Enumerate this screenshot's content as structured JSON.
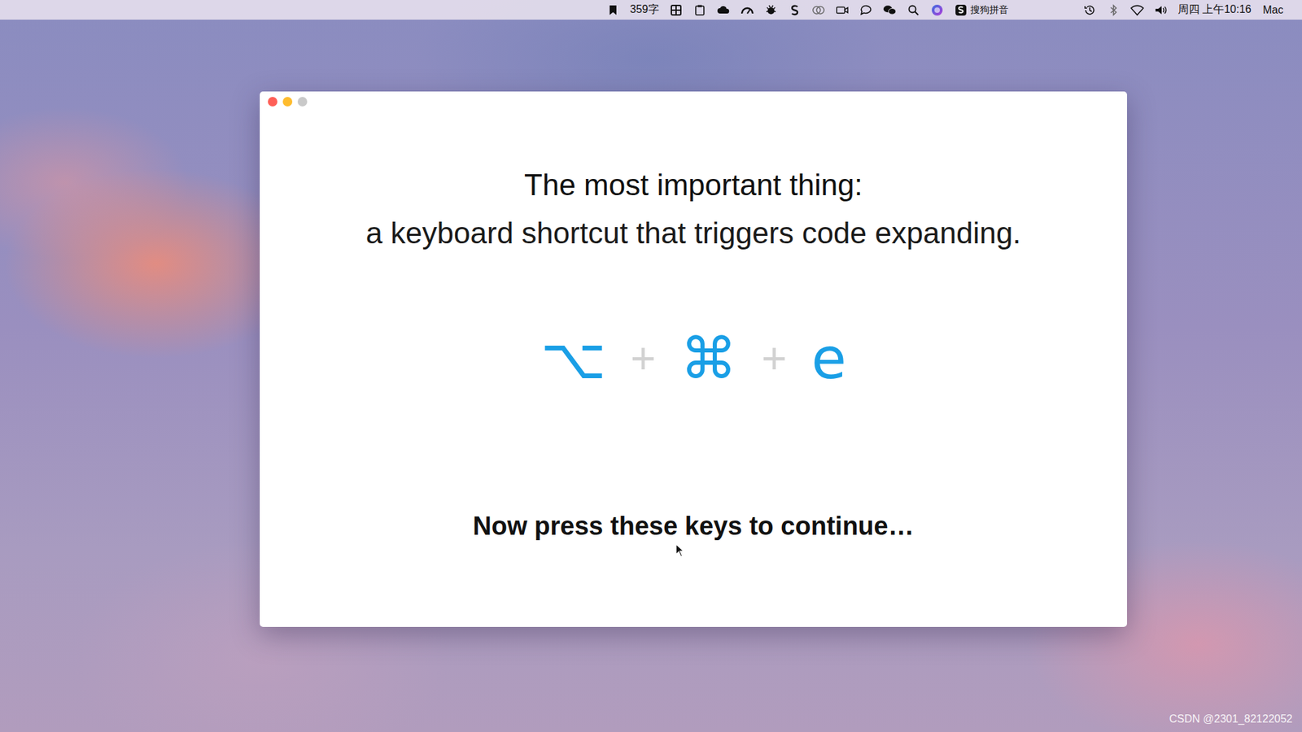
{
  "menu_bar": {
    "word_count": "359字",
    "input_method": "搜狗拼音",
    "clock": "周四 上午10:16",
    "user": "Mac"
  },
  "window": {
    "heading": "The most important thing:",
    "subheading": "a keyboard shortcut that triggers code expanding.",
    "shortcut": {
      "keys": [
        "⌥",
        "⌘",
        "e"
      ],
      "separator": "+"
    },
    "prompt": "Now press these keys to continue…"
  },
  "watermark": "CSDN @2301_82122052"
}
